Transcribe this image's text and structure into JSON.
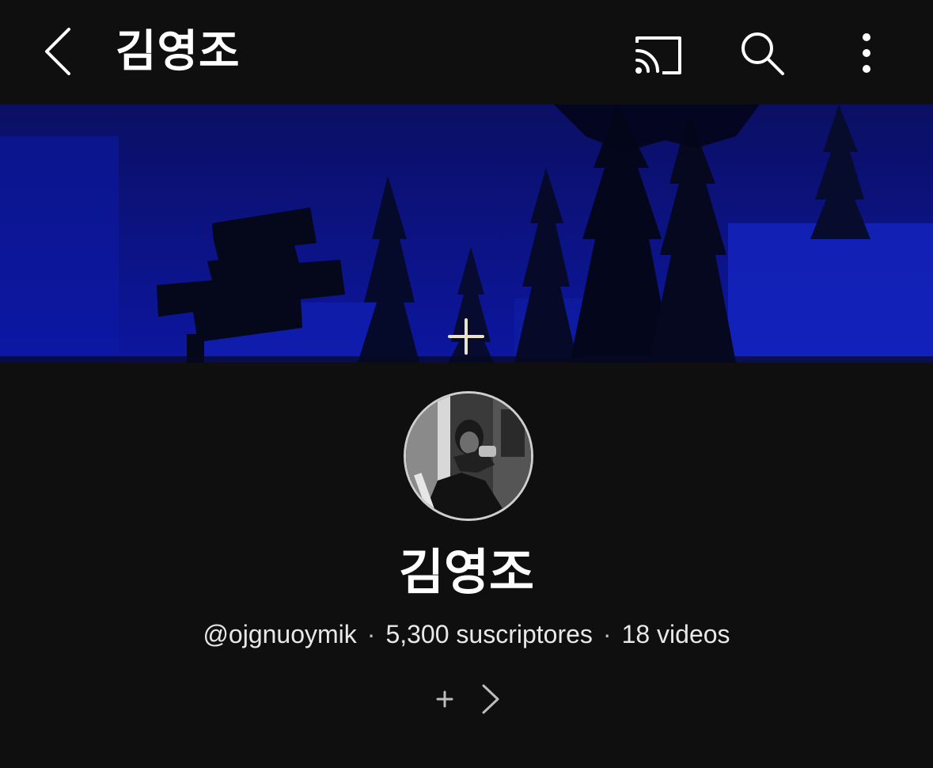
{
  "header": {
    "title": "김영조",
    "back_icon": "chevron-left-icon",
    "cast_icon": "cast-icon",
    "search_icon": "search-icon",
    "more_icon": "more-vertical-icon"
  },
  "banner": {
    "add_icon": "plus-icon",
    "color": "#0a0e6e"
  },
  "channel": {
    "name": "김영조",
    "handle": "@ojgnuoymik",
    "separator": "·",
    "subscribers": "5,300 suscriptores",
    "videos": "18 videos"
  },
  "links": {
    "add_icon": "plus-icon",
    "more_icon": "chevron-right-icon"
  },
  "colors": {
    "background": "#0f0f0f",
    "text": "#ffffff",
    "muted_text": "#e8e8e8"
  }
}
